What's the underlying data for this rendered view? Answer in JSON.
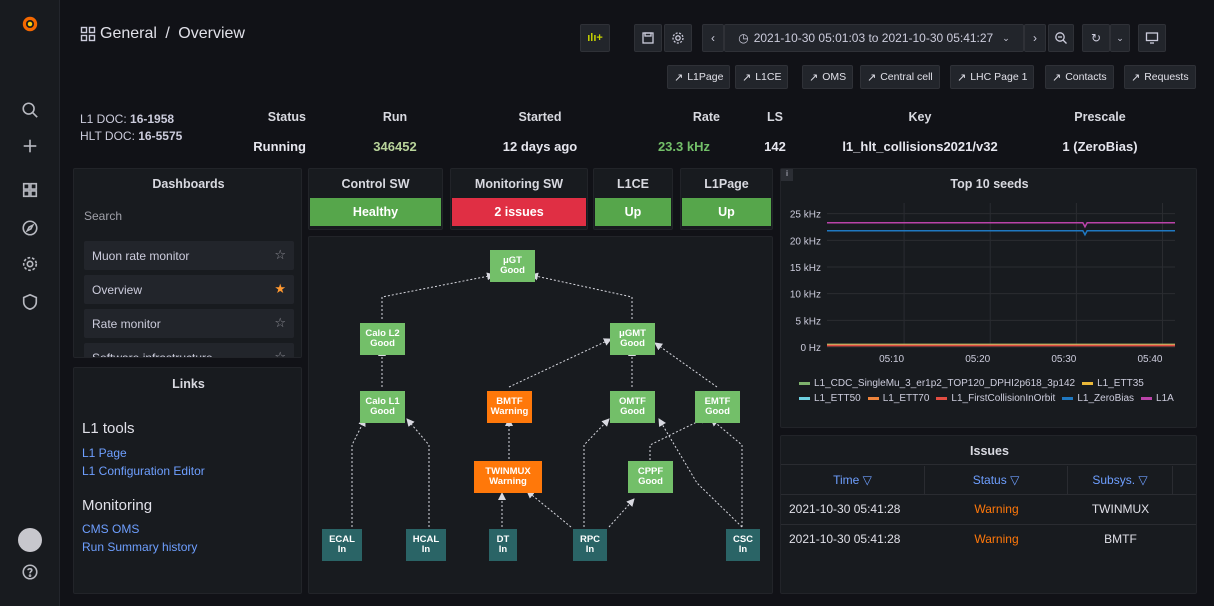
{
  "breadcrumb": {
    "folder": "General",
    "separator": "/",
    "page": "Overview"
  },
  "toolbar": {
    "time_range": "2021-10-30 05:01:03 to 2021-10-30 05:41:27",
    "add_panel_icon": "add-panel-icon",
    "save_icon": "save-icon",
    "settings_icon": "gear-icon"
  },
  "links": [
    "L1Page",
    "L1CE",
    "OMS",
    "Central cell",
    "LHC Page 1",
    "Contacts",
    "Requests"
  ],
  "docs": {
    "l1_label": "L1 DOC:",
    "l1_value": "16-1958",
    "hlt_label": "HLT DOC:",
    "hlt_value": "16-5575"
  },
  "stats": {
    "status_label": "Status",
    "status_value": "Running",
    "run_label": "Run",
    "run_value": "346452",
    "started_label": "Started",
    "started_value": "12 days ago",
    "rate_label": "Rate",
    "rate_value": "23.3 kHz",
    "ls_label": "LS",
    "ls_value": "142",
    "key_label": "Key",
    "key_value": "l1_hlt_collisions2021/v32",
    "prescale_label": "Prescale",
    "prescale_value": "1 (ZeroBias)"
  },
  "dashboards": {
    "title": "Dashboards",
    "search": "Search",
    "items": [
      {
        "label": "Muon rate monitor",
        "starred": false
      },
      {
        "label": "Overview",
        "starred": true
      },
      {
        "label": "Rate monitor",
        "starred": false
      },
      {
        "label": "Software infrastructure",
        "starred": false
      }
    ]
  },
  "links_panel": {
    "title": "Links",
    "l1_heading": "L1 tools",
    "l1_links": [
      "L1 Page",
      "L1 Configuration Editor"
    ],
    "mon_heading": "Monitoring",
    "mon_links": [
      "CMS OMS",
      "Run Summary history"
    ]
  },
  "systems": [
    {
      "title": "Control SW",
      "value": "Healthy",
      "color": "#56a64b"
    },
    {
      "title": "Monitoring SW",
      "value": "2 issues",
      "color": "#e02f44"
    },
    {
      "title": "L1CE",
      "value": "Up",
      "color": "#56a64b"
    },
    {
      "title": "L1Page",
      "value": "Up",
      "color": "#56a64b"
    }
  ],
  "nodes": {
    "ugt": {
      "name": "μGT",
      "state": "Good"
    },
    "calol2": {
      "name": "Calo L2",
      "state": "Good"
    },
    "ugmt": {
      "name": "μGMT",
      "state": "Good"
    },
    "calol1": {
      "name": "Calo L1",
      "state": "Good"
    },
    "bmtf": {
      "name": "BMTF",
      "state": "Warning"
    },
    "omtf": {
      "name": "OMTF",
      "state": "Good"
    },
    "emtf": {
      "name": "EMTF",
      "state": "Good"
    },
    "twinmux": {
      "name": "TWINMUX",
      "state": "Warning"
    },
    "cppf": {
      "name": "CPPF",
      "state": "Good"
    },
    "ecal": {
      "name": "ECAL",
      "state": "In"
    },
    "hcal": {
      "name": "HCAL",
      "state": "In"
    },
    "dt": {
      "name": "DT",
      "state": "In"
    },
    "rpc": {
      "name": "RPC",
      "state": "In"
    },
    "csc": {
      "name": "CSC",
      "state": "In"
    }
  },
  "chart_data": {
    "type": "line",
    "title": "Top 10 seeds",
    "x_ticks": [
      "05:10",
      "05:20",
      "05:30",
      "05:40"
    ],
    "y_ticks": [
      "0 Hz",
      "5 kHz",
      "10 kHz",
      "15 kHz",
      "20 kHz",
      "25 kHz"
    ],
    "ylim": [
      0,
      27000
    ],
    "xlim": [
      "05:01:03",
      "05:41:27"
    ],
    "series": [
      {
        "name": "L1_CDC_SingleMu_3_er1p2_TOP120_DPHI2p618_3p142",
        "color": "#7eb26d",
        "level": 500
      },
      {
        "name": "L1_ETT35",
        "color": "#eab839",
        "level": 450
      },
      {
        "name": "L1_ETT50",
        "color": "#6ed0e0",
        "level": 350
      },
      {
        "name": "L1_ETT70",
        "color": "#ef843c",
        "level": 300
      },
      {
        "name": "L1_FirstCollisionInOrbit",
        "color": "#e24d42",
        "level": 250
      },
      {
        "name": "L1_ZeroBias",
        "color": "#1f78c1",
        "level": 21800
      },
      {
        "name": "L1A",
        "color": "#ba43a9",
        "level": 23300
      }
    ]
  },
  "issues": {
    "title": "Issues",
    "columns": [
      "Time",
      "Status",
      "Subsys."
    ],
    "rows": [
      {
        "time": "2021-10-30 05:41:28",
        "status": "Warning",
        "subsys": "TWINMUX"
      },
      {
        "time": "2021-10-30 05:41:28",
        "status": "Warning",
        "subsys": "BMTF"
      }
    ]
  },
  "colors": {
    "good": "#73bf69",
    "warning": "#ff780a",
    "input": "#2a6466",
    "link": "#6e9fff"
  }
}
